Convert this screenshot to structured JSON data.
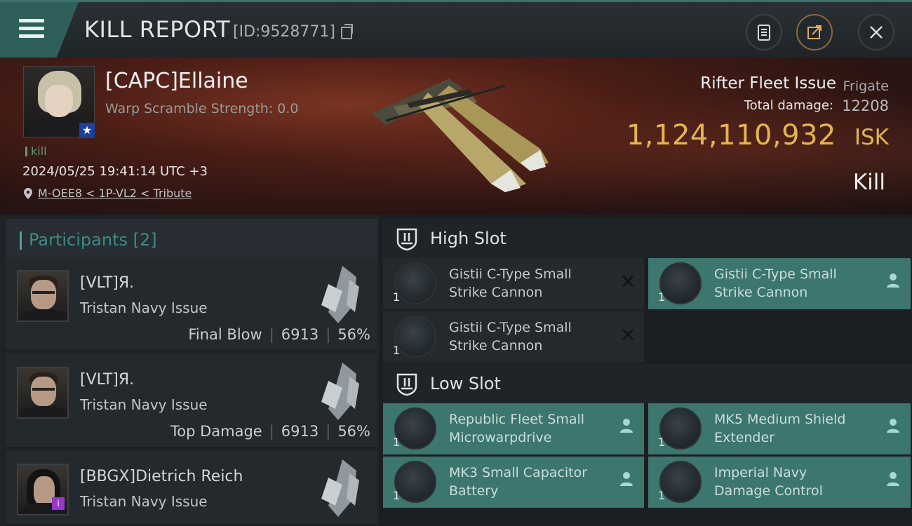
{
  "header": {
    "title": "KILL REPORT",
    "report_id": "[ID:9528771]"
  },
  "victim": {
    "name": "[CAPC]Ellaine",
    "warp_scramble": "Warp Scramble Strength: 0.0",
    "kill_tag": "kill",
    "timestamp": "2024/05/25 19:41:14 UTC +3",
    "location": "M-OEE8 < 1P-VL2 < Tribute",
    "ship_name": "Rifter Fleet Issue",
    "ship_class": "Frigate",
    "damage_label": "Total damage:",
    "damage_value": "12208",
    "isk_value": "1,124,110,932",
    "isk_unit": "ISK",
    "kill_type": "Kill"
  },
  "participants": {
    "label": "Participants",
    "count": "[2]",
    "items": [
      {
        "name": "[VLT]Я.",
        "ship": "Tristan Navy Issue",
        "role": "Final Blow",
        "damage": "6913",
        "percent": "56%"
      },
      {
        "name": "[VLT]Я.",
        "ship": "Tristan Navy Issue",
        "role": "Top Damage",
        "damage": "6913",
        "percent": "56%"
      },
      {
        "name": "[BBGX]Dietrich Reich",
        "ship": "Tristan Navy Issue"
      }
    ]
  },
  "fitting": {
    "high_slot": {
      "label": "High Slot",
      "modules": [
        {
          "name_line1": "Gistii C-Type Small",
          "name_line2": "Strike Cannon",
          "qty": "1",
          "state": "destroyed"
        },
        {
          "name_line1": "Gistii C-Type Small",
          "name_line2": "Strike Cannon",
          "qty": "1",
          "state": "dropped"
        },
        {
          "name_line1": "Gistii C-Type Small",
          "name_line2": "Strike Cannon",
          "qty": "1",
          "state": "destroyed"
        }
      ]
    },
    "low_slot": {
      "label": "Low Slot",
      "modules": [
        {
          "name_line1": "Republic Fleet Small",
          "name_line2": "Microwarpdrive",
          "qty": "1",
          "state": "dropped"
        },
        {
          "name_line1": "MK5 Medium Shield",
          "name_line2": "Extender",
          "qty": "1",
          "state": "dropped"
        },
        {
          "name_line1": "MK3 Small Capacitor",
          "name_line2": "Battery",
          "qty": "1",
          "state": "dropped"
        },
        {
          "name_line1": "Imperial Navy",
          "name_line2": "Damage Control",
          "qty": "1",
          "state": "dropped"
        }
      ]
    }
  },
  "colors": {
    "accent_teal": "#3d756f",
    "isk_gold": "#e3b452",
    "kill_green": "#5e9c77"
  }
}
